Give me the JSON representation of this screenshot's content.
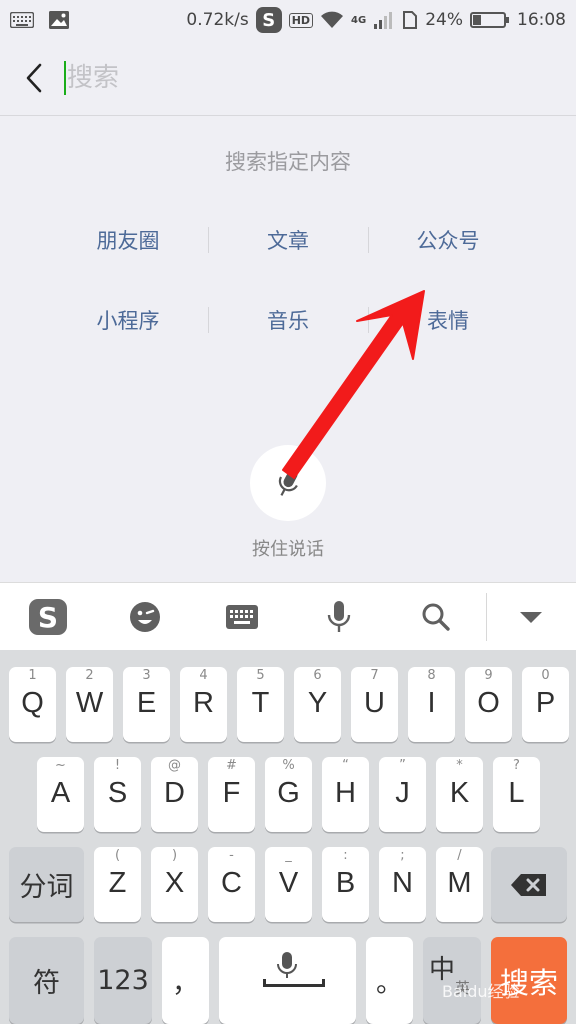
{
  "status_bar": {
    "speed": "0.72k/s",
    "sogou_badge": "S",
    "hd_badge": "HD",
    "network": "4G",
    "battery_percent": "24%",
    "time": "16:08"
  },
  "search": {
    "placeholder": "搜索",
    "value": ""
  },
  "section_title": "搜索指定内容",
  "categories": [
    [
      "朋友圈",
      "文章",
      "公众号"
    ],
    [
      "小程序",
      "音乐",
      "表情"
    ]
  ],
  "voice_label": "按住说话",
  "annotation": {
    "arrow_color": "#f21b1b"
  },
  "keyboard_toolbar": {
    "logo": "S",
    "icons": [
      "emoji-icon",
      "keyboard-icon",
      "microphone-icon",
      "search-icon",
      "collapse-icon"
    ]
  },
  "keyboard": {
    "row1": [
      {
        "sub": "1",
        "main": "Q"
      },
      {
        "sub": "2",
        "main": "W"
      },
      {
        "sub": "3",
        "main": "E"
      },
      {
        "sub": "4",
        "main": "R"
      },
      {
        "sub": "5",
        "main": "T"
      },
      {
        "sub": "6",
        "main": "Y"
      },
      {
        "sub": "7",
        "main": "U"
      },
      {
        "sub": "8",
        "main": "I"
      },
      {
        "sub": "9",
        "main": "O"
      },
      {
        "sub": "0",
        "main": "P"
      }
    ],
    "row2": [
      {
        "sub": "~",
        "main": "A"
      },
      {
        "sub": "!",
        "main": "S"
      },
      {
        "sub": "@",
        "main": "D"
      },
      {
        "sub": "#",
        "main": "F"
      },
      {
        "sub": "%",
        "main": "G"
      },
      {
        "sub": "“",
        "main": "H"
      },
      {
        "sub": "”",
        "main": "J"
      },
      {
        "sub": "*",
        "main": "K"
      },
      {
        "sub": "?",
        "main": "L"
      }
    ],
    "row3": [
      {
        "sub": "(",
        "main": "Z"
      },
      {
        "sub": ")",
        "main": "X"
      },
      {
        "sub": "-",
        "main": "C"
      },
      {
        "sub": "_",
        "main": "V"
      },
      {
        "sub": ":",
        "main": "B"
      },
      {
        "sub": ";",
        "main": "N"
      },
      {
        "sub": "/",
        "main": "M"
      }
    ],
    "word_split": "分词",
    "symbol": "符",
    "numbers": "123",
    "comma": "，",
    "period": "。",
    "lang": "中",
    "lang_sub": "英",
    "search_key": "搜索"
  },
  "watermark": "Baidu经验"
}
